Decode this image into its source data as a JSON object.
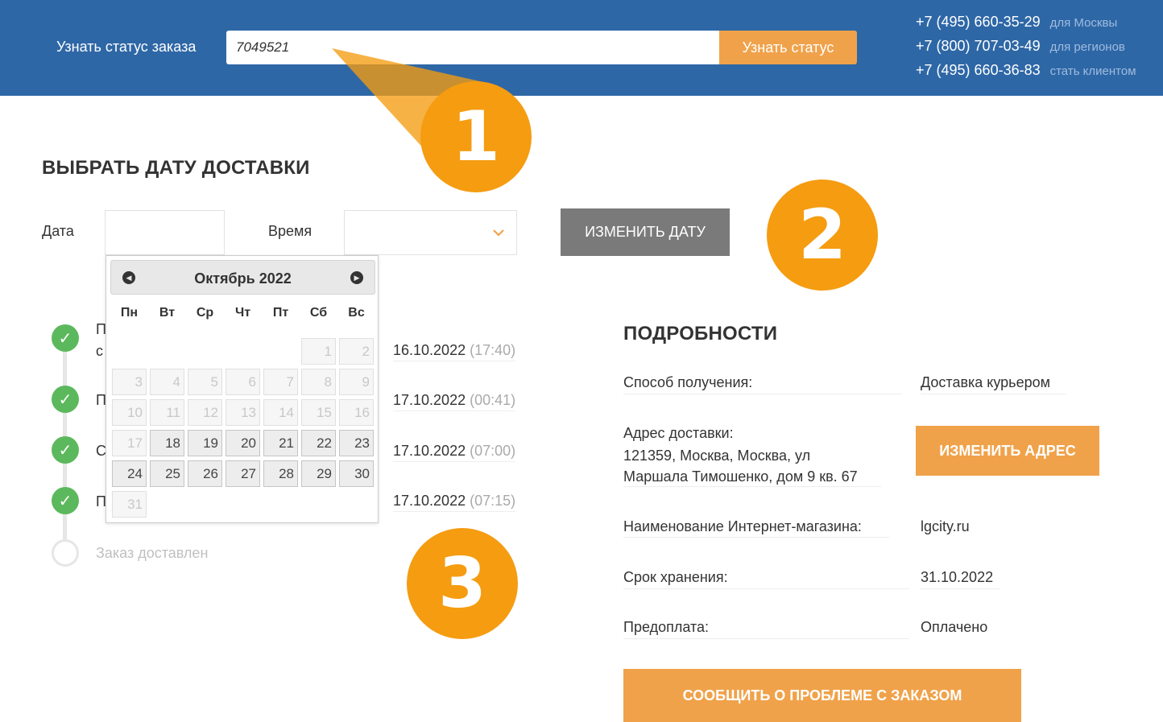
{
  "header": {
    "track_label": "Узнать статус заказа",
    "order_input_value": "7049521",
    "track_button": "Узнать статус",
    "phones": [
      {
        "number": "+7 (495) 660-35-29",
        "note": "для Москвы"
      },
      {
        "number": "+7 (800) 707-03-49",
        "note": "для регионов"
      },
      {
        "number": "+7 (495) 660-36-83",
        "note": "стать клиентом"
      }
    ]
  },
  "delivery": {
    "title": "ВЫБРАТЬ ДАТУ ДОСТАВКИ",
    "date_label": "Дата",
    "date_value": "",
    "time_label": "Время",
    "time_value": "",
    "change_date_button": "ИЗМЕНИТЬ ДАТУ"
  },
  "datepicker": {
    "month_title": "Октябрь 2022",
    "weekdays": [
      "Пн",
      "Вт",
      "Ср",
      "Чт",
      "Пт",
      "Сб",
      "Вс"
    ],
    "days": [
      {
        "d": "",
        "s": "blank"
      },
      {
        "d": "",
        "s": "blank"
      },
      {
        "d": "",
        "s": "blank"
      },
      {
        "d": "",
        "s": "blank"
      },
      {
        "d": "",
        "s": "blank"
      },
      {
        "d": "1",
        "s": "disabled"
      },
      {
        "d": "2",
        "s": "disabled"
      },
      {
        "d": "3",
        "s": "disabled"
      },
      {
        "d": "4",
        "s": "disabled"
      },
      {
        "d": "5",
        "s": "disabled"
      },
      {
        "d": "6",
        "s": "disabled"
      },
      {
        "d": "7",
        "s": "disabled"
      },
      {
        "d": "8",
        "s": "disabled"
      },
      {
        "d": "9",
        "s": "disabled"
      },
      {
        "d": "10",
        "s": "disabled"
      },
      {
        "d": "11",
        "s": "disabled"
      },
      {
        "d": "12",
        "s": "disabled"
      },
      {
        "d": "13",
        "s": "disabled"
      },
      {
        "d": "14",
        "s": "disabled"
      },
      {
        "d": "15",
        "s": "disabled"
      },
      {
        "d": "16",
        "s": "disabled"
      },
      {
        "d": "17",
        "s": "disabled"
      },
      {
        "d": "18",
        "s": "active"
      },
      {
        "d": "19",
        "s": "active"
      },
      {
        "d": "20",
        "s": "active"
      },
      {
        "d": "21",
        "s": "active"
      },
      {
        "d": "22",
        "s": "active"
      },
      {
        "d": "23",
        "s": "active"
      },
      {
        "d": "24",
        "s": "active"
      },
      {
        "d": "25",
        "s": "active"
      },
      {
        "d": "26",
        "s": "active"
      },
      {
        "d": "27",
        "s": "active"
      },
      {
        "d": "28",
        "s": "active"
      },
      {
        "d": "29",
        "s": "active"
      },
      {
        "d": "30",
        "s": "active"
      },
      {
        "d": "31",
        "s": "disabled"
      }
    ]
  },
  "timeline": {
    "steps": [
      {
        "text_line1": "П",
        "text_line2": "с",
        "date": "16.10.2022",
        "time": "(17:40)",
        "done": true
      },
      {
        "text_line1": "П",
        "date": "17.10.2022",
        "time": "(00:41)",
        "done": true
      },
      {
        "text_line1": "С",
        "date": "17.10.2022",
        "time": "(07:00)",
        "done": true
      },
      {
        "text_line1": "П",
        "date": "17.10.2022",
        "time": "(07:15)",
        "done": true
      },
      {
        "text_line1": "Заказ доставлен",
        "date": "",
        "time": "",
        "done": false
      }
    ]
  },
  "details": {
    "title": "ПОДРОБНОСТИ",
    "receive_label": "Способ получения:",
    "receive_value": "Доставка курьером",
    "address_label": "Адрес доставки:",
    "address_line1": "121359, Москва, Москва, ул",
    "address_line2": "Маршала Тимошенко, дом 9 кв. 67",
    "change_address_button": "ИЗМЕНИТЬ АДРЕС",
    "shop_label": "Наименование Интернет-магазина:",
    "shop_value": "lgcity.ru",
    "storage_label": "Срок хранения:",
    "storage_value": "31.10.2022",
    "prepay_label": "Предоплата:",
    "prepay_value": "Оплачено",
    "report_button": "СООБЩИТЬ О ПРОБЛЕМЕ С ЗАКАЗОМ"
  },
  "callouts": [
    "1",
    "2",
    "3"
  ],
  "colors": {
    "header_bg": "#2e67a6",
    "accent_orange": "#f0a24a",
    "callout_orange": "#f59c11",
    "success_green": "#5cb85c",
    "gray_button": "#7a7a7a"
  }
}
